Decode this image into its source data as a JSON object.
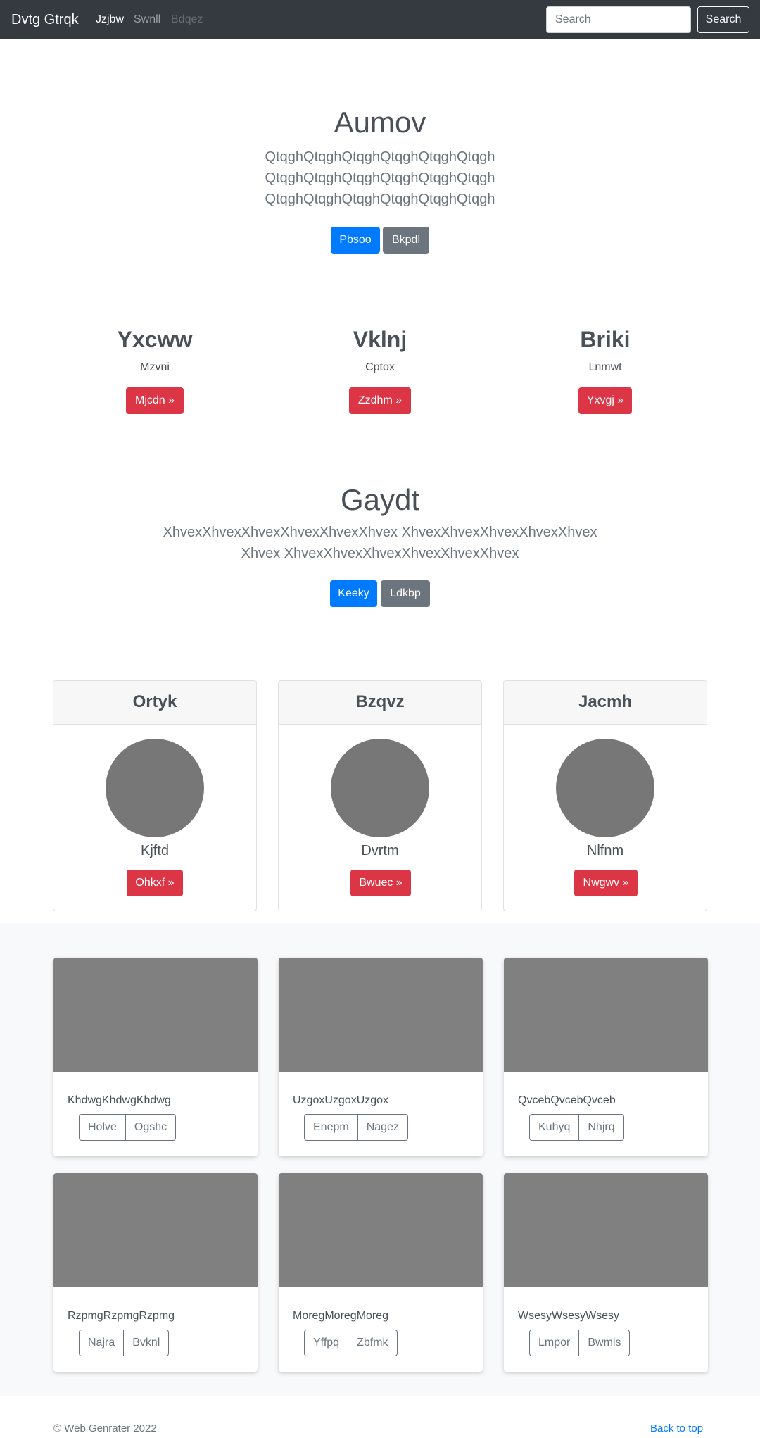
{
  "navbar": {
    "brand": "Dvtg Gtrqk",
    "links": [
      "Jzjbw",
      "Swnll",
      "Bdqez"
    ],
    "search_placeholder": "Search",
    "search_button": "Search"
  },
  "hero": {
    "title": "Aumov",
    "lead": "QtqghQtqghQtqghQtqghQtqghQtqgh QtqghQtqghQtqghQtqghQtqghQtqgh QtqghQtqghQtqghQtqghQtqghQtqgh",
    "primary_button": "Pbsoo",
    "secondary_button": "Bkpdl"
  },
  "features": [
    {
      "title": "Yxcww",
      "subtitle": "Mzvni",
      "button": "Mjcdn »"
    },
    {
      "title": "Vklnj",
      "subtitle": "Cptox",
      "button": "Zzdhm »"
    },
    {
      "title": "Briki",
      "subtitle": "Lnmwt",
      "button": "Yxvgj »"
    }
  ],
  "section2": {
    "title": "Gaydt",
    "lead": "XhvexXhvexXhvexXhvexXhvexXhvex XhvexXhvexXhvexXhvexXhvexXhvex XhvexXhvexXhvexXhvexXhvexXhvex",
    "primary_button": "Keeky",
    "secondary_button": "Ldkbp"
  },
  "profiles": [
    {
      "header": "Ortyk",
      "name": "Kjftd",
      "button": "Ohkxf »"
    },
    {
      "header": "Bzqvz",
      "name": "Dvrtm",
      "button": "Bwuec »"
    },
    {
      "header": "Jacmh",
      "name": "Nlfnm",
      "button": "Nwgwv »"
    }
  ],
  "album": [
    {
      "text": "KhdwgKhdwgKhdwg",
      "buttons": [
        "Holve",
        "Ogshc"
      ]
    },
    {
      "text": "UzgoxUzgoxUzgox",
      "buttons": [
        "Enepm",
        "Nagez"
      ]
    },
    {
      "text": "QvcebQvcebQvceb",
      "buttons": [
        "Kuhyq",
        "Nhjrq"
      ]
    },
    {
      "text": "RzpmgRzpmgRzpmg",
      "buttons": [
        "Najra",
        "Bvknl"
      ]
    },
    {
      "text": "MoregMoregMoreg",
      "buttons": [
        "Yffpq",
        "Zbfmk"
      ]
    },
    {
      "text": "WsesyWsesyWsesy",
      "buttons": [
        "Lmpor",
        "Bwmls"
      ]
    }
  ],
  "footer": {
    "copyright": "© Web Genrater 2022",
    "back_to_top": "Back to top"
  },
  "colors": {
    "navbar": "#343a40",
    "primary": "#007bff",
    "secondary": "#6c757d",
    "danger": "#dc3545",
    "placeholder_gray": "#808080"
  }
}
